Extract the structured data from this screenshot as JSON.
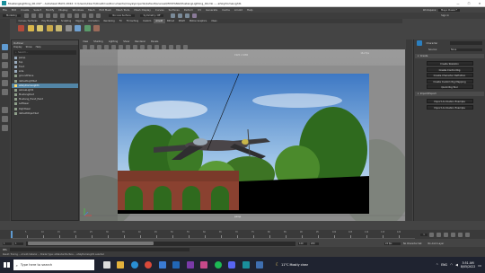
{
  "window": {
    "title": "MustangLighting_00.mb* - Autodesk MAYA 2022: C:\\Users\\Czech\\OneDrive\\Documents\\maya\\projects\\default\\scenes\\MUSTANG\\MustangLighting_00.mb  ---  aiSkyDomeLight1"
  },
  "menu": {
    "items": [
      "File",
      "Edit",
      "Create",
      "Select",
      "Modify",
      "Display",
      "Windows",
      "Mesh",
      "Edit Mesh",
      "Mesh Tools",
      "Mesh Display",
      "Curves",
      "Surfaces",
      "Deform",
      "UV",
      "Generate",
      "Cache",
      "Arnold",
      "Help"
    ],
    "workspace_label": "Workspace:",
    "workspace_value": "Maya Classic*"
  },
  "statusline": {
    "mode": "Modeling",
    "live_surface": "No Live Surface",
    "symmetry": "Symmetry: Off",
    "sign_in": "Sign In"
  },
  "shelf": {
    "tabs": [
      "Curves / Surfaces",
      "Poly Modeling",
      "Sculpting",
      "Rigging",
      "Animation",
      "Rendering",
      "FX",
      "FX Caching",
      "Custom",
      "Arnold",
      "Bifrost",
      "MASH",
      "Motion Graphics",
      "XGen"
    ]
  },
  "outliner": {
    "title": "Outliner",
    "menus": [
      "Display",
      "Show",
      "Help"
    ],
    "search_placeholder": "Search...",
    "items": [
      "persp",
      "top",
      "front",
      "side",
      "groundPlane",
      "defaultLightSet",
      "aiSkyDomeLight1",
      "aiAreaLight1",
      "MustangRoot",
      "Mustang_Hand_Paint",
      "LeftGear",
      "RightGear",
      "defaultObjectSet"
    ]
  },
  "viewport": {
    "menus": [
      "View",
      "Shading",
      "Lighting",
      "Show",
      "Renderer",
      "Panels"
    ],
    "camera_label": "persp",
    "fps": "16.2 fps",
    "size_label": "1920 x 1080"
  },
  "character": {
    "title": "Character",
    "source_label": "Source:",
    "source_value": "None",
    "section": "Create",
    "buttons": [
      "Create Skeleton",
      "Create Control Rig",
      "Create Character Definition",
      "Create Custom Rig Mapping",
      "Quick Rig Tool"
    ],
    "section2": "Import/Export",
    "buttons2": [
      "Import Animation Example",
      "Import Animation Example"
    ]
  },
  "timeline": {
    "ticks": [
      "5",
      "10",
      "15",
      "20",
      "25",
      "30",
      "35",
      "40",
      "45",
      "50",
      "55",
      "60",
      "65",
      "70",
      "75",
      "80",
      "85",
      "90",
      "95",
      "100",
      "105",
      "110",
      "115",
      "120"
    ],
    "current_frame": "1",
    "start": "1",
    "end": "120",
    "range_start": "1",
    "range_end": "200",
    "fps": "24 fps",
    "char_set": "No Character Set",
    "anim_layer": "No Anim Layer"
  },
  "cmdline": {
    "lang": "MEL",
    "help": "Result: Tracing ... Arnold material ... Shader type: aiStandardSurface ... aiSkyDomeLight1 selected"
  },
  "taskbar": {
    "search_placeholder": "Type here to search",
    "weather": "11°C  Mostly clear",
    "lang": "ENG",
    "time": "3:51 AM",
    "date": "8/05/2022"
  },
  "colors": {
    "maya_bg": "#444444",
    "panel": "#3c3c3c",
    "selected_row": "#5285a6",
    "highlight": "#5f9ad0",
    "taskbar": "#1f2330"
  }
}
